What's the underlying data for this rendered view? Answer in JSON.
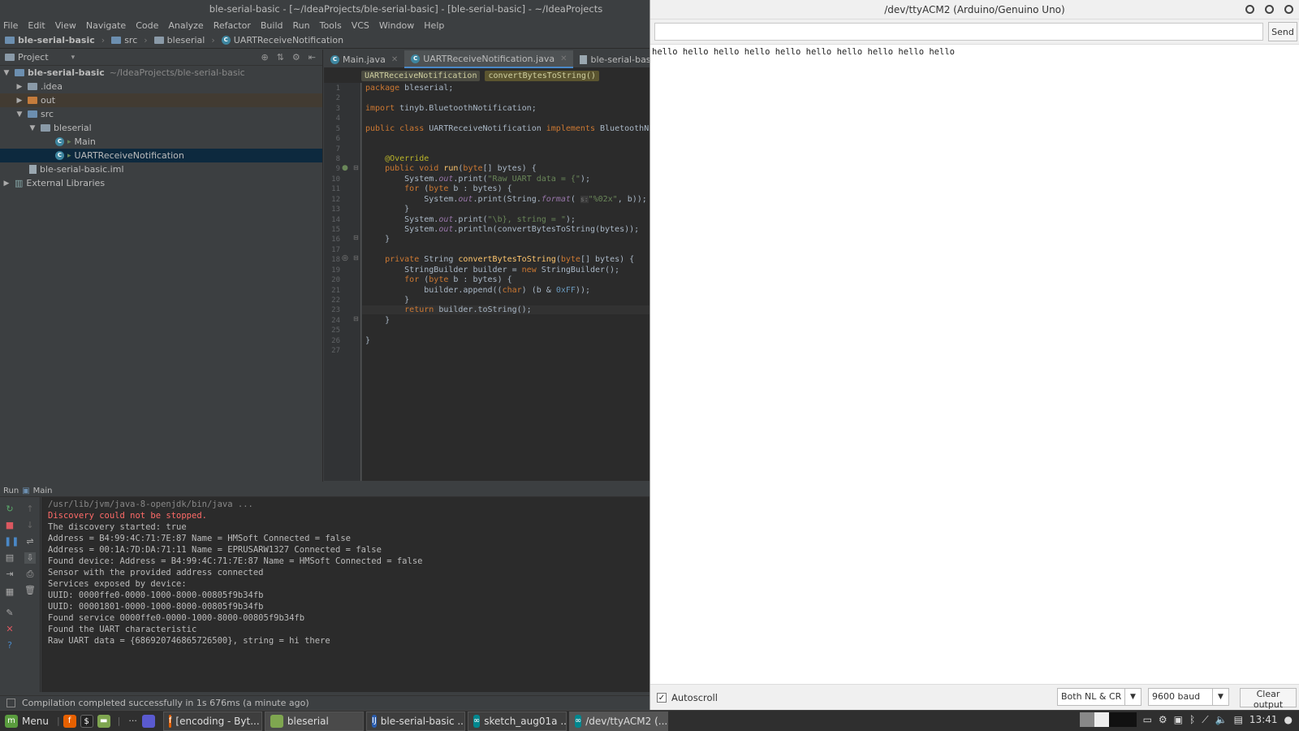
{
  "ide": {
    "window_title": "ble-serial-basic - [~/IdeaProjects/ble-serial-basic] - [ble-serial-basic] - ~/IdeaProjects",
    "menu": [
      "File",
      "Edit",
      "View",
      "Navigate",
      "Code",
      "Analyze",
      "Refactor",
      "Build",
      "Run",
      "Tools",
      "VCS",
      "Window",
      "Help"
    ],
    "breadcrumbs": [
      "ble-serial-basic",
      "src",
      "bleserial",
      "UARTReceiveNotification"
    ],
    "project_label": "Project",
    "tree": {
      "root": "ble-serial-basic",
      "root_path": "~/IdeaProjects/ble-serial-basic",
      "idea": ".idea",
      "out": "out",
      "src": "src",
      "bleserial": "bleserial",
      "main": "Main",
      "uart": "UARTReceiveNotification",
      "iml": "ble-serial-basic.iml",
      "ext": "External Libraries"
    },
    "tabs": [
      "Main.java",
      "UARTReceiveNotification.java",
      "ble-serial-basic.iml"
    ],
    "editor_crumbs": [
      "UARTReceiveNotification",
      "convertBytesToString()"
    ],
    "code": {
      "l1_kw": "package",
      "l1": " bleserial;",
      "l3_kw": "import",
      "l3": " tinyb.BluetoothNotification;",
      "l5_kw1": "public class",
      "l5a": " UARTReceiveNotification ",
      "l5_kw2": "implements",
      "l5b": " BluetoothNot",
      "l8": "    @Override",
      "l9_kw": "    public void ",
      "l9_fn": "run",
      "l9_a": "(",
      "l9_kw2": "byte",
      "l9_b": "[] bytes) {",
      "l10_a": "        System.",
      "l10_it": "out",
      "l10_b": ".print(",
      "l10_str": "\"Raw UART data = {\"",
      "l10_c": ");",
      "l11_kw": "        for",
      "l11_a": " (",
      "l11_kw2": "byte",
      "l11_b": " b : bytes) {",
      "l12_a": "            System.",
      "l12_it": "out",
      "l12_b": ".print(String.",
      "l12_it2": "format",
      "l12_c": "( ",
      "l12_hint": "s:",
      "l12_str": "\"%02x\"",
      "l12_d": ", b));",
      "l13": "        }",
      "l14_a": "        System.",
      "l14_it": "out",
      "l14_b": ".print(",
      "l14_str": "\"\\b}, string = \"",
      "l14_c": ");",
      "l15_a": "        System.",
      "l15_it": "out",
      "l15_b": ".println(convertBytesToString(bytes));",
      "l16": "    }",
      "l18_kw": "    private",
      "l18_a": " String ",
      "l18_fn": "convertBytesToString",
      "l18_b": "(",
      "l18_kw2": "byte",
      "l18_c": "[] bytes) {",
      "l19_a": "        StringBuilder builder = ",
      "l19_kw": "new",
      "l19_b": " StringBuilder();",
      "l20_kw": "        for",
      "l20_a": " (",
      "l20_kw2": "byte",
      "l20_b": " b : bytes) {",
      "l21_a": "            builder.append((",
      "l21_kw": "char",
      "l21_b": ") (b & ",
      "l21_num": "0xFF",
      "l21_c": "));",
      "l22": "        }",
      "l23_kw": "        return",
      "l23_a": " builder.toString();",
      "l24": "    }",
      "l26": "}"
    },
    "run_tab": {
      "label": "Run",
      "config": "Main"
    },
    "console": [
      "/usr/lib/jvm/java-8-openjdk/bin/java ...",
      "Discovery could not be stopped.",
      "The discovery started: true",
      "Address = B4:99:4C:71:7E:87 Name = HMSoft Connected = false",
      "Address = 00:1A:7D:DA:71:11 Name = EPRUSARW1327 Connected = false",
      "Found device: Address = B4:99:4C:71:7E:87 Name = HMSoft Connected = false",
      "Sensor with the provided address connected",
      "Services exposed by device:",
      "UUID: 0000ffe0-0000-1000-8000-00805f9b34fb",
      "UUID: 00001801-0000-1000-8000-00805f9b34fb",
      "Found service 0000ffe0-0000-1000-8000-00805f9b34fb",
      "Found the UART characteristic",
      "Raw UART data = {686920746865726500}, string = hi there"
    ],
    "status": "Compilation completed successfully in 1s 676ms (a minute ago)"
  },
  "serial": {
    "title": "/dev/ttyACM2 (Arduino/Genuino Uno)",
    "send_value": "",
    "send_label": "Send",
    "output": "hello hello hello hello hello hello hello hello hello hello",
    "autoscroll_label": "Autoscroll",
    "autoscroll_checked": true,
    "line_ending": "Both NL & CR",
    "baud": "9600 baud",
    "clear_label": "Clear output"
  },
  "taskbar": {
    "menu_label": "Menu",
    "ellipsis": "···",
    "tasks": [
      "[encoding - Byt...",
      "bleserial",
      "ble-serial-basic ...",
      "sketch_aug01a ...",
      "/dev/ttyACM2 (..."
    ],
    "clock": "13:41"
  },
  "colors": {
    "ide_bg": "#3c3f41",
    "editor_bg": "#2b2b2b",
    "keyword": "#cc7832",
    "string": "#6a8759",
    "error_text": "#ff6b68",
    "selection": "#0d293e"
  }
}
